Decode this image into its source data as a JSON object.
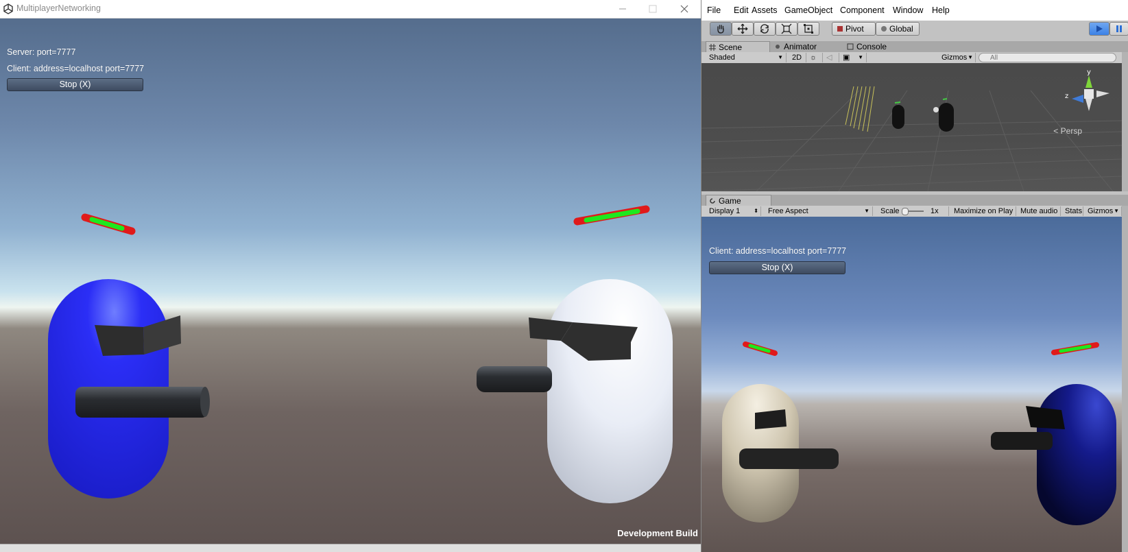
{
  "game_window": {
    "title": "MultiplayerNetworking",
    "server_text": "Server: port=7777",
    "client_text": "Client: address=localhost port=7777",
    "stop_button": "Stop (X)",
    "dev_build": "Development Build"
  },
  "editor": {
    "menu": [
      "File",
      "Edit",
      "Assets",
      "GameObject",
      "Component",
      "Window",
      "Help"
    ],
    "toolbar": {
      "pivot": "Pivot",
      "global": "Global"
    },
    "scene_tabs": [
      "Scene",
      "Animator",
      "Console"
    ],
    "scene_toolbar": {
      "shading": "Shaded",
      "mode_2d": "2D",
      "gizmos": "Gizmos",
      "search_placeholder": "All"
    },
    "persp_label": "Persp",
    "gizmo_axis": {
      "y": "y",
      "z": "z"
    },
    "game_tab": "Game",
    "game_toolbar": {
      "display": "Display 1",
      "aspect": "Free Aspect",
      "scale_label": "Scale",
      "scale_value": "1x",
      "maximize": "Maximize on Play",
      "mute": "Mute audio",
      "stats": "Stats",
      "gizmos": "Gizmos"
    },
    "game_view": {
      "client_text": "Client: address=localhost port=7777",
      "stop_button": "Stop (X)"
    }
  },
  "colors": {
    "player_blue": "#2a2df5",
    "player_white": "#e8ecf5",
    "health_green": "#1ee81e",
    "health_red": "#e01a1a",
    "play_active": "#3c82e6"
  }
}
